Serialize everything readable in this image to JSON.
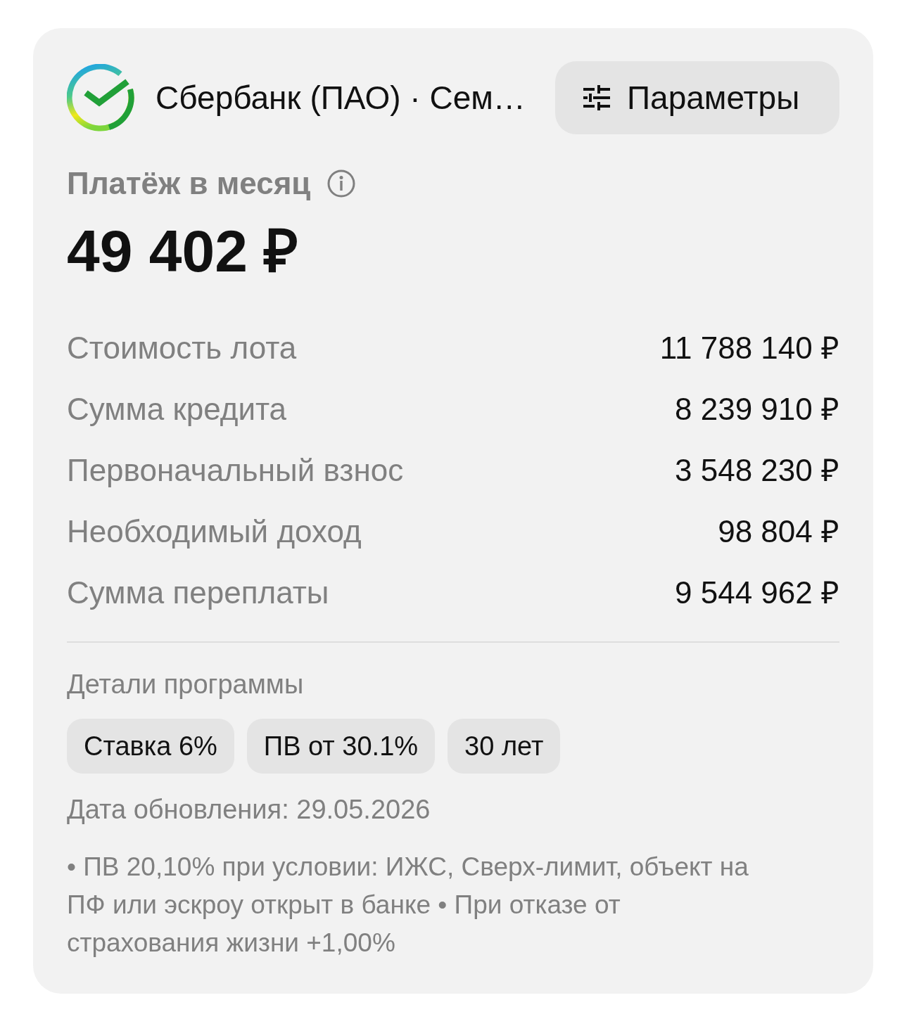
{
  "header": {
    "bank_name": "Сбербанк (ПАО) · Сем…",
    "params_button": "Параметры"
  },
  "payment": {
    "label": "Платёж в месяц",
    "amount": "49 402 ₽"
  },
  "summary": [
    {
      "label": "Стоимость лота",
      "value": "11 788 140 ₽"
    },
    {
      "label": "Сумма кредита",
      "value": "8 239 910 ₽"
    },
    {
      "label": "Первоначальный взнос",
      "value": "3 548 230 ₽"
    },
    {
      "label": "Необходимый доход",
      "value": "98 804 ₽"
    },
    {
      "label": "Сумма переплаты",
      "value": "9 544 962 ₽"
    }
  ],
  "program": {
    "title": "Детали программы",
    "tags": [
      "Ставка 6%",
      "ПВ от 30.1%",
      "30 лет"
    ]
  },
  "updated": "Дата обновления: 29.05.2026",
  "note": "• ПВ 20,10% при условии: ИЖС, Сверх-лимит, объект на ПФ или эскроу открыт в банке • При отказе от страхования жизни +1,00%"
}
